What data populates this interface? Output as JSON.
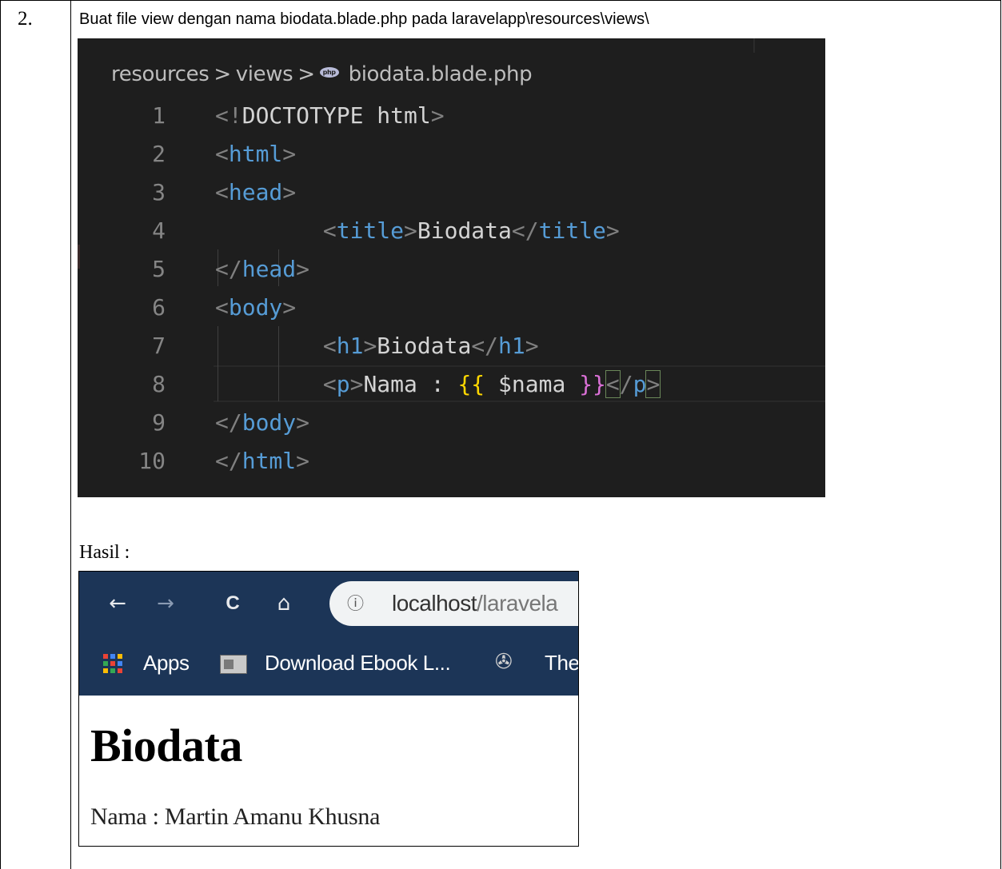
{
  "step": {
    "number": "2.",
    "instruction": "Buat file view dengan nama biodata.blade.php pada laravelapp\\resources\\views\\"
  },
  "editor": {
    "breadcrumb": {
      "folder1": "resources",
      "folder2": "views",
      "file_icon": "php-file-icon",
      "file_icon_text": "php",
      "file": "biodata.blade.php",
      "separator": ">"
    },
    "lines": [
      {
        "n": "1",
        "tokens": [
          [
            "gray",
            "<!"
          ],
          [
            "white",
            "DOCTOTYPE html"
          ],
          [
            "gray",
            ">"
          ]
        ]
      },
      {
        "n": "2",
        "tokens": [
          [
            "gray",
            "<"
          ],
          [
            "blue",
            "html"
          ],
          [
            "gray",
            ">"
          ]
        ]
      },
      {
        "n": "3",
        "tokens": [
          [
            "gray",
            "<"
          ],
          [
            "blue",
            "head"
          ],
          [
            "gray",
            ">"
          ]
        ]
      },
      {
        "n": "4",
        "tokens": [
          [
            "white",
            "        "
          ],
          [
            "gray",
            "<"
          ],
          [
            "blue",
            "title"
          ],
          [
            "gray",
            ">"
          ],
          [
            "white",
            "Biodata"
          ],
          [
            "gray",
            "</"
          ],
          [
            "blue",
            "title"
          ],
          [
            "gray",
            ">"
          ]
        ]
      },
      {
        "n": "5",
        "tokens": [
          [
            "gray",
            "</"
          ],
          [
            "blue",
            "head"
          ],
          [
            "gray",
            ">"
          ]
        ]
      },
      {
        "n": "6",
        "tokens": [
          [
            "gray",
            "<"
          ],
          [
            "blue",
            "body"
          ],
          [
            "gray",
            ">"
          ]
        ]
      },
      {
        "n": "7",
        "tokens": [
          [
            "white",
            "        "
          ],
          [
            "gray",
            "<"
          ],
          [
            "blue",
            "h1"
          ],
          [
            "gray",
            ">"
          ],
          [
            "white",
            "Biodata"
          ],
          [
            "gray",
            "</"
          ],
          [
            "blue",
            "h1"
          ],
          [
            "gray",
            ">"
          ]
        ]
      },
      {
        "n": "8",
        "tokens": [
          [
            "white",
            "        "
          ],
          [
            "gray",
            "<"
          ],
          [
            "blue",
            "p"
          ],
          [
            "gray",
            ">"
          ],
          [
            "white",
            "Nama : "
          ],
          [
            "gold",
            "{{"
          ],
          [
            "white",
            " $nama "
          ],
          [
            "pink",
            "}}"
          ],
          [
            "gray",
            "<"
          ],
          [
            "gray",
            "/"
          ],
          [
            "blue",
            "p"
          ],
          [
            "gray",
            ">"
          ]
        ]
      },
      {
        "n": "9",
        "tokens": [
          [
            "gray",
            "</"
          ],
          [
            "blue",
            "body"
          ],
          [
            "gray",
            ">"
          ]
        ]
      },
      {
        "n": "10",
        "tokens": [
          [
            "gray",
            "</"
          ],
          [
            "blue",
            "html"
          ],
          [
            "gray",
            ">"
          ]
        ]
      }
    ]
  },
  "result_label": "Hasil :",
  "browser": {
    "nav": {
      "back_icon": "←",
      "forward_icon": "→",
      "reload_icon": "C",
      "home_icon": "⌂",
      "info_icon": "ⓘ"
    },
    "url_host": "localhost",
    "url_rest": "/laravela",
    "bookmarks": {
      "apps": "Apps",
      "ebook": "Download Ebook L...",
      "third": "The"
    },
    "page": {
      "heading": "Biodata",
      "paragraph": "Nama : Martin Amanu Khusna"
    }
  }
}
